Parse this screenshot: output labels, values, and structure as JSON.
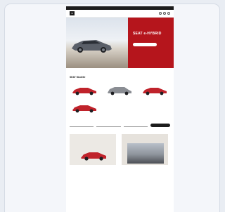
{
  "topbar": {
    "links": [
      "",
      "",
      ""
    ]
  },
  "nav": {
    "logo": "S",
    "links": [
      "",
      "",
      "",
      "",
      ""
    ]
  },
  "hero": {
    "title": "SEAT e-HYBRID",
    "subtitle": "",
    "cta": ""
  },
  "models_section": {
    "title": "SEAT Modelle",
    "models": [
      {
        "name": "",
        "price": "",
        "cta": "",
        "color": "#c0232b"
      },
      {
        "name": "",
        "price": "",
        "cta": "",
        "color": "#8a8d93"
      },
      {
        "name": "",
        "price": "",
        "cta": "",
        "color": "#c0232b"
      },
      {
        "name": "",
        "price": "",
        "cta": "",
        "color": "#c0232b"
      }
    ]
  },
  "finder": {
    "title": "",
    "fields": [
      "",
      "",
      ""
    ],
    "button": "",
    "note": ""
  },
  "promos": [
    {
      "title": ""
    },
    {
      "title": ""
    }
  ],
  "colors": {
    "brand_red": "#b5151c",
    "dark": "#1c1c1c"
  }
}
